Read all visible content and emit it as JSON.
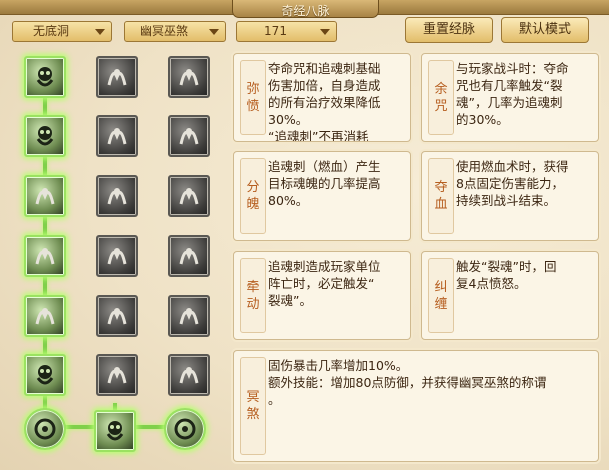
{
  "window": {
    "title": "奇经八脉"
  },
  "toolbar": {
    "school_dropdown": "无底洞",
    "subschool_dropdown": "幽冥巫煞",
    "level_dropdown": "171",
    "reset_button": "重置经脉",
    "default_button": "默认模式"
  },
  "tree": {
    "icons": [
      "spirit-icon",
      "fork-icon",
      "claw-icon",
      "spirit-icon",
      "hands-icon",
      "trident-icon",
      "skull-icon",
      "dancer-icon",
      "swirl-icon",
      "hand-icon",
      "rose-icon",
      "vortex-icon",
      "claw-icon",
      "skull-icon",
      "wave-icon",
      "spirit-icon",
      "book-icon",
      "beast-icon",
      "orb-icon",
      "spirit-icon",
      "orb-icon"
    ]
  },
  "cards": [
    {
      "name": "弥\n愤",
      "desc": "夺命咒和追魂刺基础\n伤害加倍，自身造成\n的所有治疗效果降低\n30%。\n“追魂刺”不再消耗"
    },
    {
      "name": "余\n咒",
      "desc": "与玩家战斗时：夺命\n咒也有几率触发“裂\n魂”，几率为追魂刺\n的30%。"
    },
    {
      "name": "分\n魄",
      "desc": "追魂刺（燃血）产生\n目标魂魄的几率提高\n80%。"
    },
    {
      "name": "夺\n血",
      "desc": "使用燃血术时，获得\n8点固定伤害能力，\n持续到战斗结束。"
    },
    {
      "name": "牵\n动",
      "desc": "追魂刺造成玩家单位\n阵亡时，必定触发“\n裂魂”。"
    },
    {
      "name": "纠\n缠",
      "desc": "触发“裂魂”时，回\n复4点愤怒。"
    },
    {
      "name": "冥\n煞",
      "desc": "固伤暴击几率增加10%。\n额外技能：增加80点防御，并获得幽冥巫煞的称谓\n。"
    }
  ],
  "colors": {
    "accent": "#b65e1f",
    "active_glow": "#9be261"
  }
}
